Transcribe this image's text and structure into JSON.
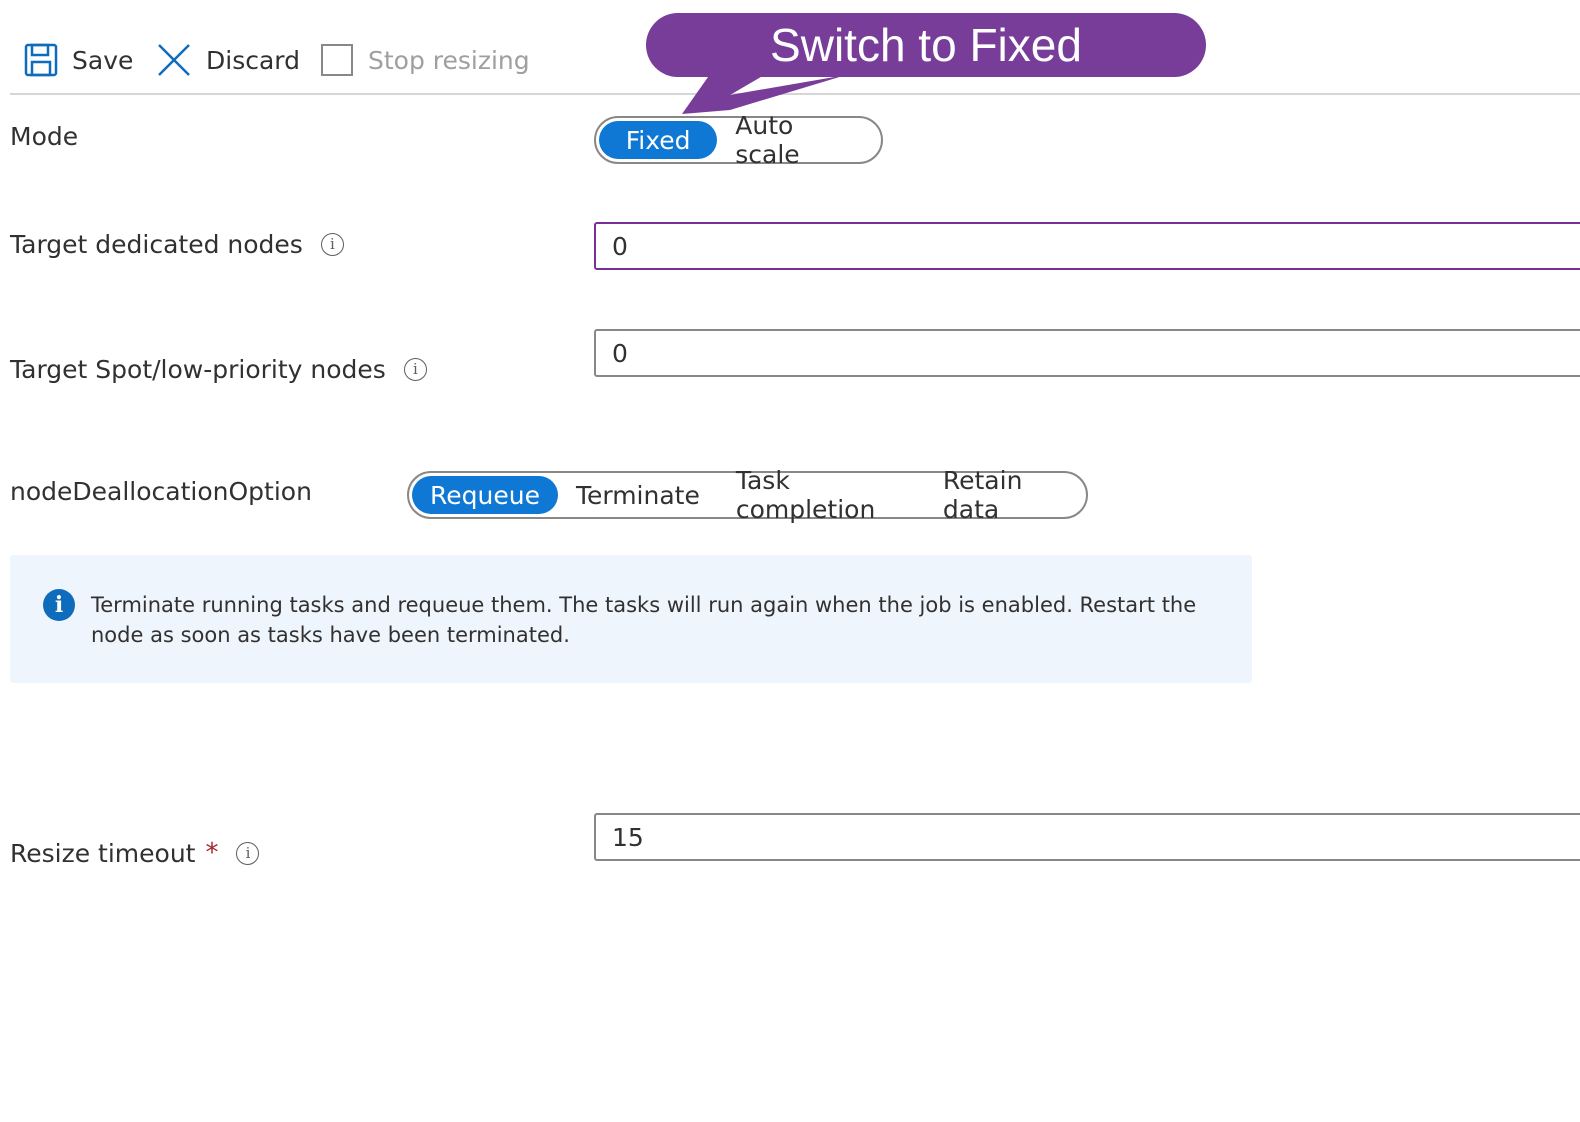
{
  "toolbar": {
    "save_label": "Save",
    "discard_label": "Discard",
    "stop_label": "Stop resizing"
  },
  "callout": {
    "text": "Switch to Fixed"
  },
  "mode": {
    "label": "Mode",
    "options": [
      "Fixed",
      "Auto scale"
    ],
    "selected": "Fixed"
  },
  "dedicated": {
    "label": "Target dedicated nodes",
    "value": "0",
    "info_icon": "info-circle-icon"
  },
  "spot": {
    "label": "Target Spot/low-priority nodes",
    "value": "0",
    "info_icon": "info-circle-icon"
  },
  "dealloc": {
    "label": "nodeDeallocationOption",
    "options": [
      "Requeue",
      "Terminate",
      "Task completion",
      "Retain data"
    ],
    "selected": "Requeue"
  },
  "info": {
    "icon": "info-filled-icon",
    "message": "Terminate running tasks and requeue them. The tasks will run again when the job is enabled. Restart the node as soon as tasks have been terminated."
  },
  "resize": {
    "label": "Resize timeout",
    "required_mark": "*",
    "value": "15",
    "info_icon": "info-circle-icon"
  },
  "colors": {
    "accent": "#0f78d4",
    "callout": "#773d99",
    "info_bg": "#eef5fd",
    "focus_border": "#7a2f96"
  }
}
